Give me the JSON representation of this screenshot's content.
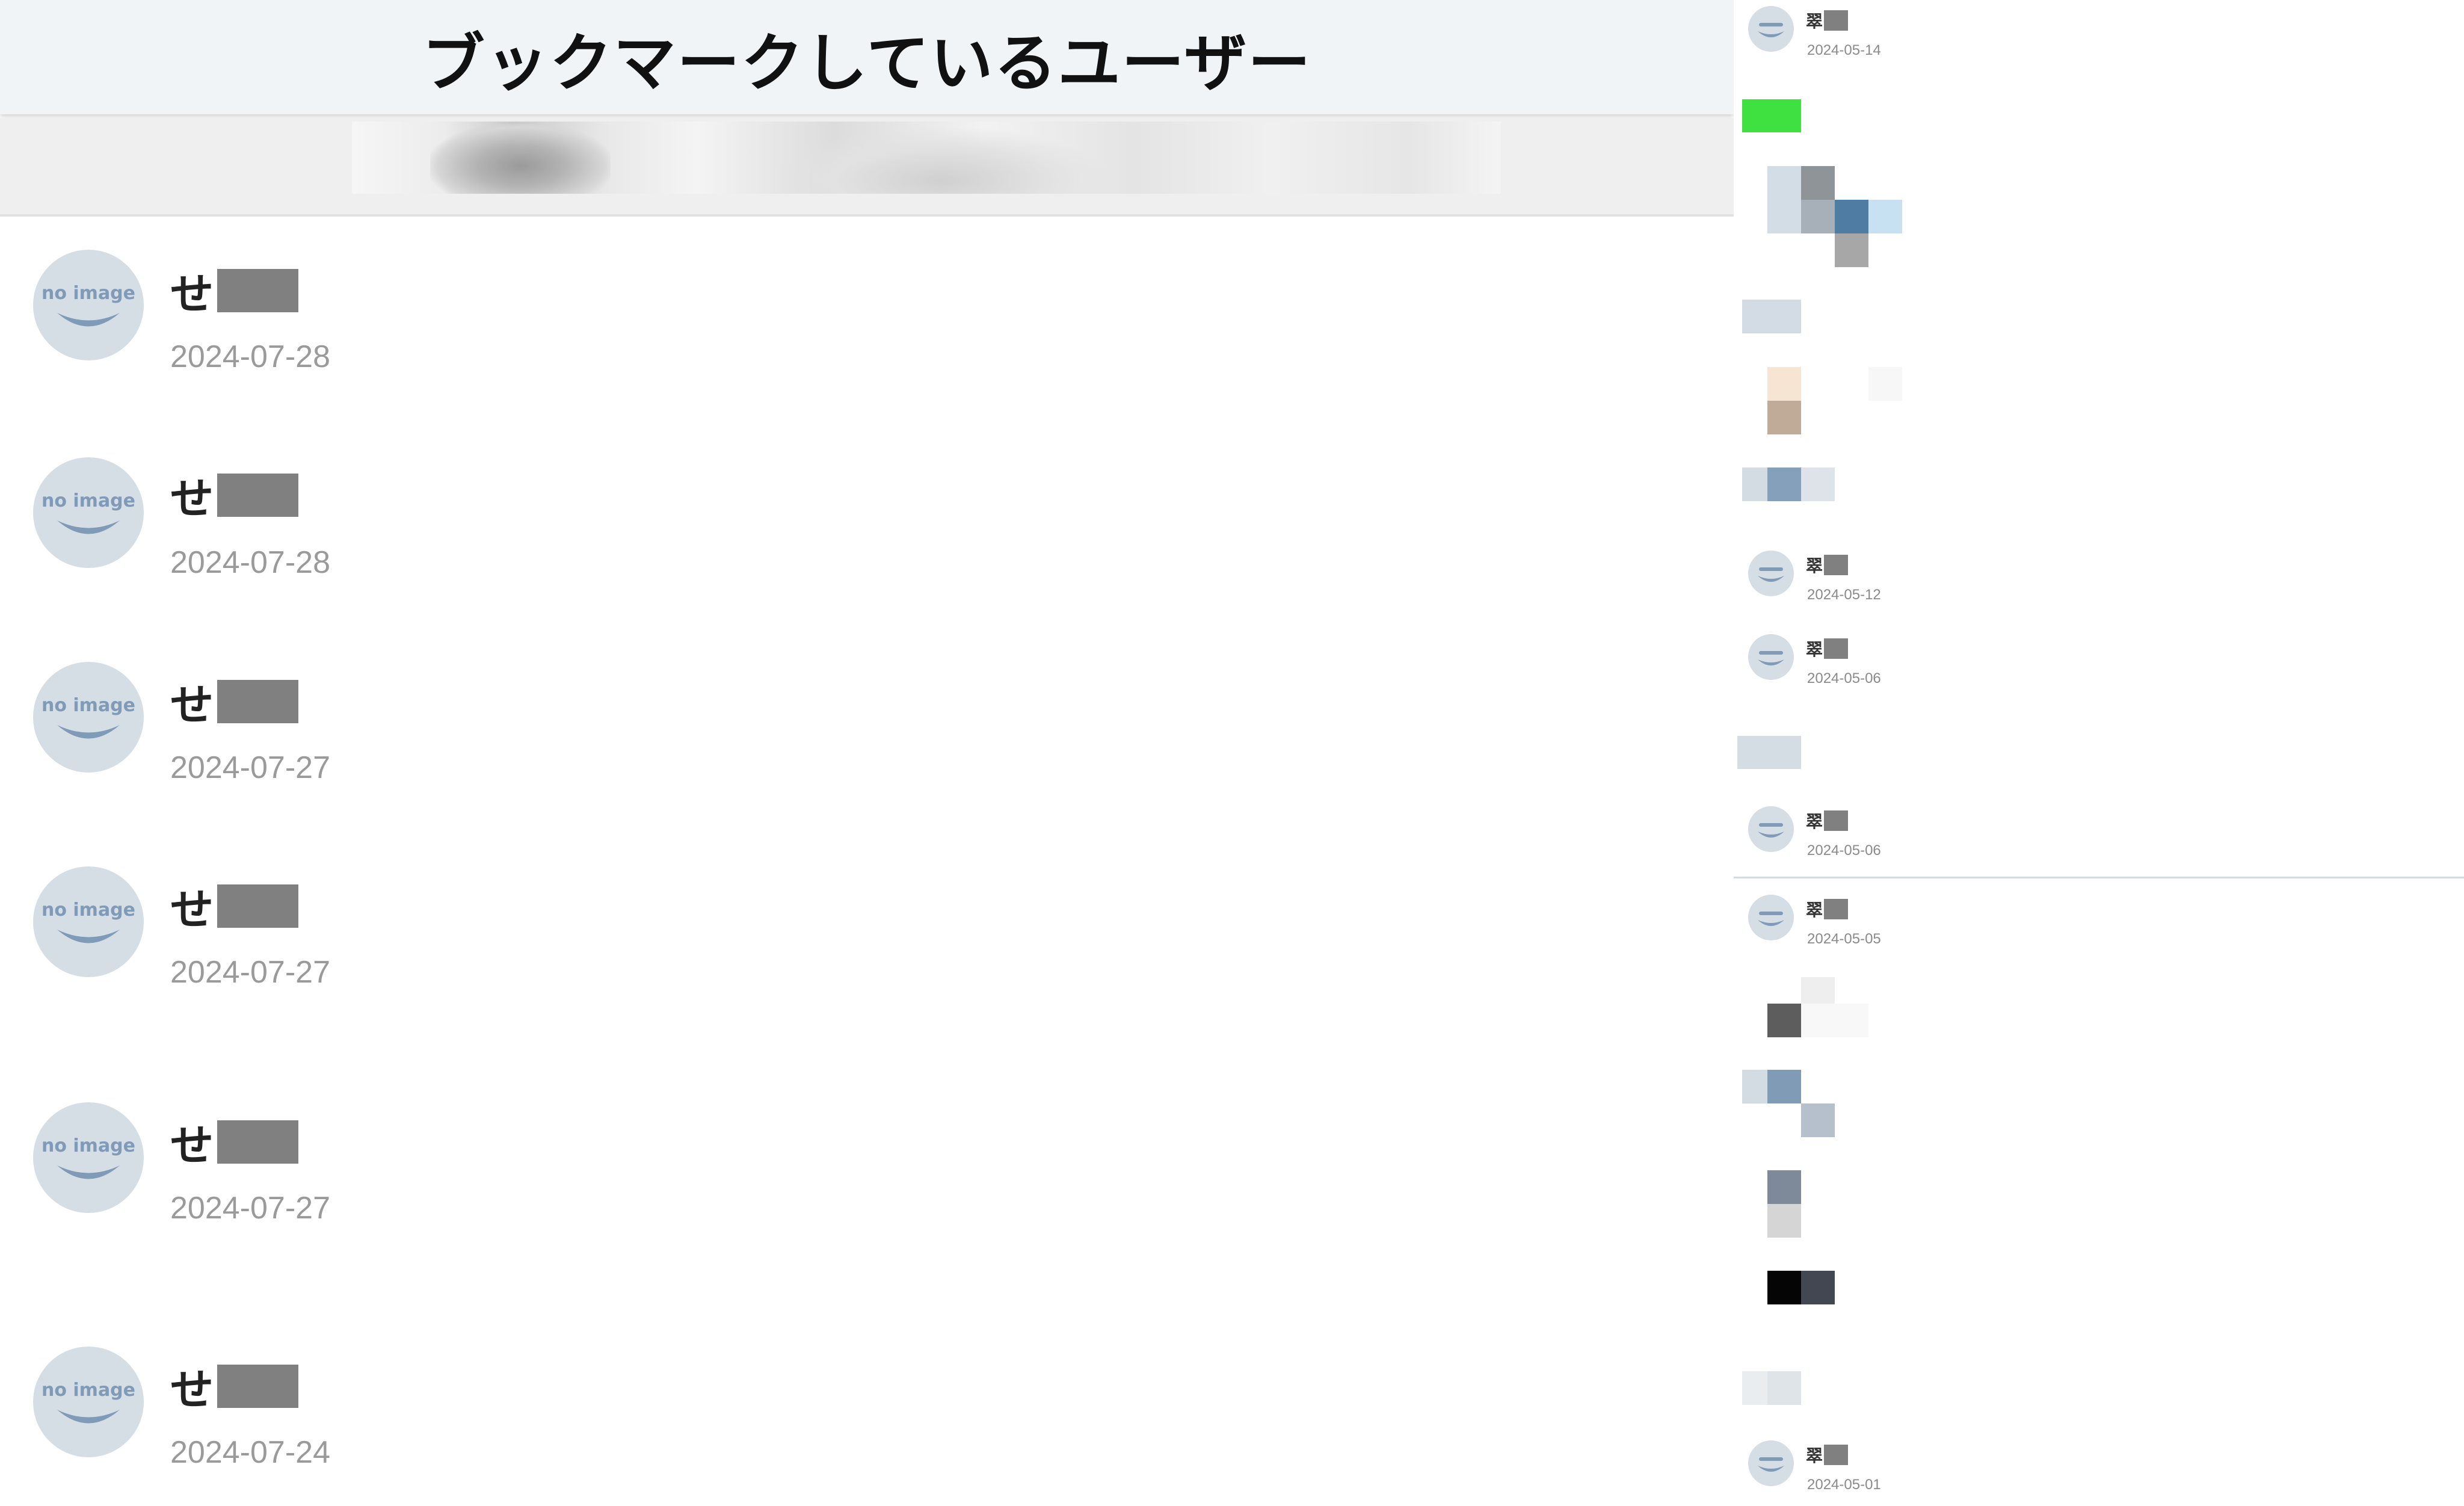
{
  "header": {
    "title": "ブックマークしているユーザー"
  },
  "users": [
    {
      "name": "せ",
      "date": "2024-07-28"
    },
    {
      "name": "せ",
      "date": "2024-07-28"
    },
    {
      "name": "せ",
      "date": "2024-07-27"
    },
    {
      "name": "せ",
      "date": "2024-07-27"
    },
    {
      "name": "せ",
      "date": "2024-07-27"
    },
    {
      "name": "せ",
      "date": "2024-07-24"
    }
  ],
  "sidebar": {
    "users": [
      {
        "name": "翠",
        "date": "2024-05-14"
      },
      {
        "name": "翠",
        "date": "2024-05-12"
      },
      {
        "name": "翠",
        "date": "2024-05-06"
      },
      {
        "name": "翠",
        "date": "2024-05-06"
      },
      {
        "name": "翠",
        "date": "2024-05-05"
      },
      {
        "name": "翠",
        "date": "2024-05-01"
      }
    ]
  },
  "avatar_placeholder": {
    "text": "no image"
  },
  "colors": {
    "header_bg": "#f0f4f7",
    "avatar_bg": "#d5dde5",
    "avatar_fg": "#7f9bb8",
    "date_text": "#9a9a9a",
    "redaction": "#808080"
  }
}
